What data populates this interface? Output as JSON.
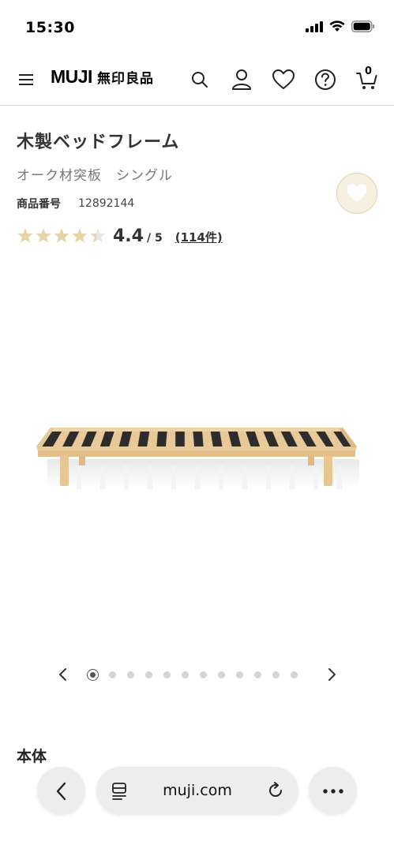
{
  "status_bar": {
    "time": "15:30"
  },
  "header": {
    "brand_latin": "MUJI",
    "brand_jp": "無印良品",
    "cart_count": "0",
    "icons": [
      "menu-icon",
      "search-icon",
      "account-icon",
      "heart-icon",
      "help-icon",
      "cart-icon"
    ]
  },
  "product": {
    "title": "木製ベッドフレーム",
    "variant": "オーク材突板　シングル",
    "sku_label": "商品番号",
    "sku_value": "12892144",
    "rating_value": "4.4",
    "rating_max": "/ 5",
    "rating_stars": 4.4,
    "review_count": "(114件)"
  },
  "carousel": {
    "total": 12,
    "active_index": 0
  },
  "section": {
    "heading": "本体"
  },
  "browser": {
    "domain": "muji.com"
  },
  "colors": {
    "star": "#e6d3a6",
    "star_empty": "#e6e6e6",
    "fav_bg": "#f6f0e1",
    "wood": "#e8c99a"
  }
}
